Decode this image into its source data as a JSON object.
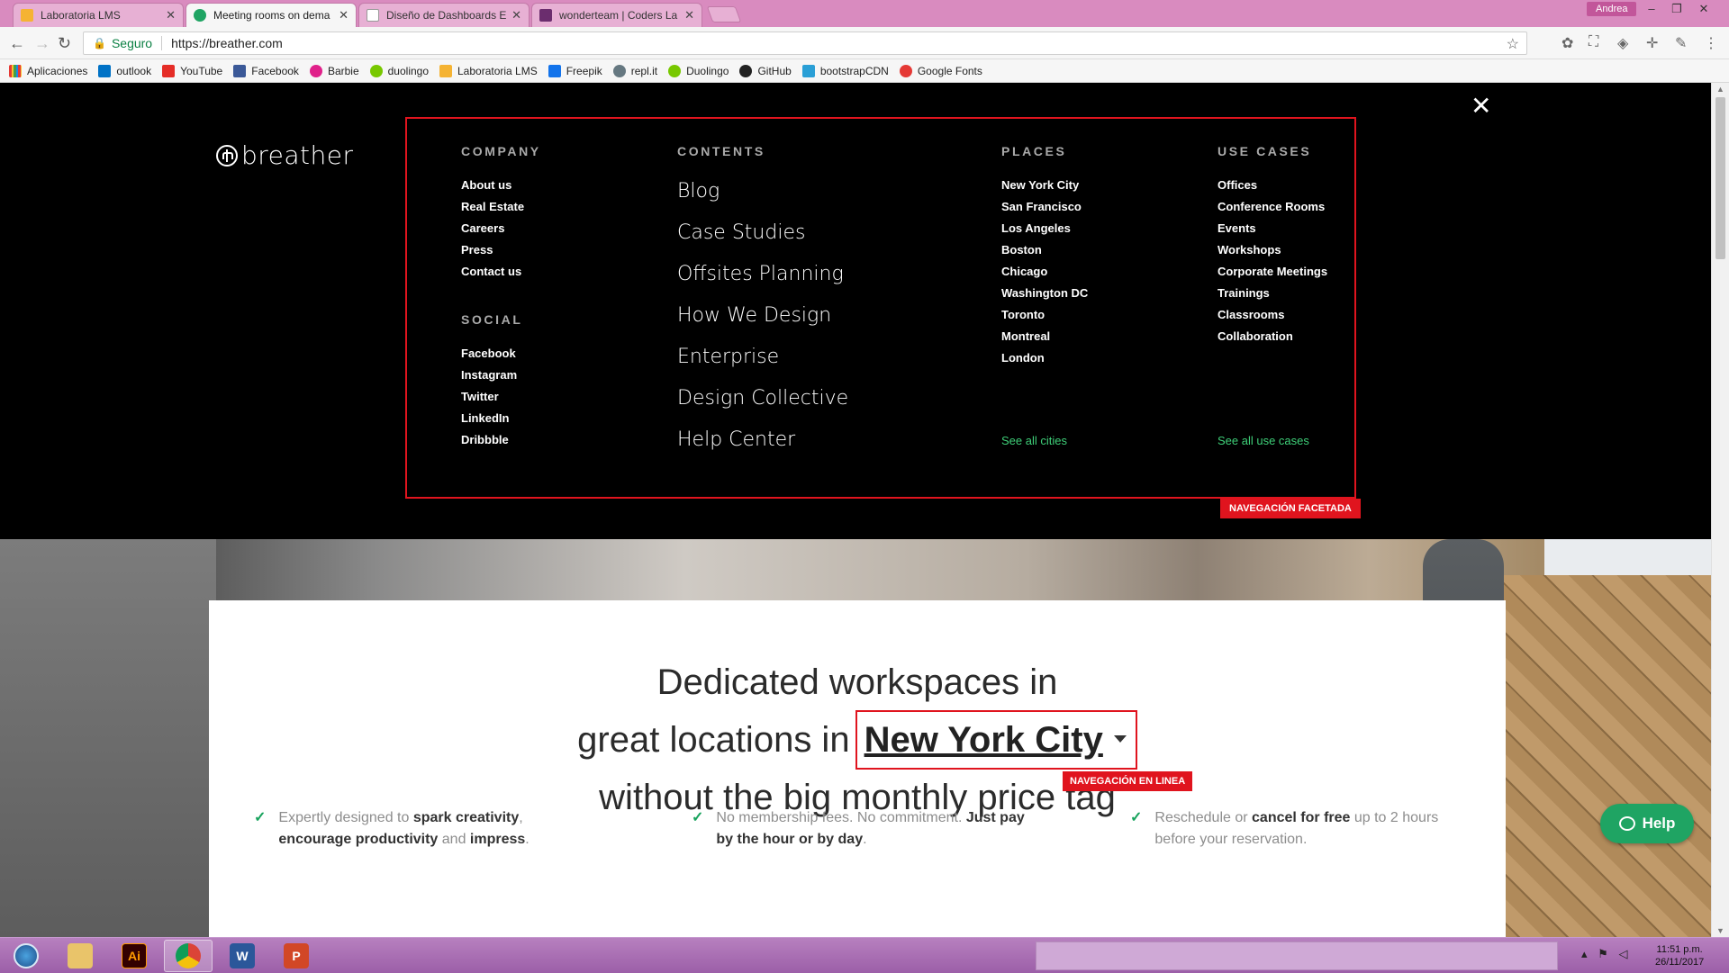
{
  "browser": {
    "tabs": [
      {
        "title": "Laboratoria LMS",
        "active": false,
        "favicon_color": "#f5b333"
      },
      {
        "title": "Meeting rooms on dema",
        "active": true,
        "favicon_color": "#1fa463"
      },
      {
        "title": "Diseño de Dashboards E",
        "active": false,
        "favicon_color": "#9e9e9e"
      },
      {
        "title": "wonderteam | Coders La",
        "active": false,
        "favicon_color": "#6b2d6e"
      }
    ],
    "user": "Andrea",
    "address": {
      "secure_label": "Seguro",
      "url": "https://breather.com"
    },
    "bookmarks": [
      {
        "label": "Aplicaciones",
        "icon": "apps-grid-icon",
        "color": "#e53935"
      },
      {
        "label": "outlook",
        "icon": "outlook-icon",
        "color": "#0072c6"
      },
      {
        "label": "YouTube",
        "icon": "youtube-icon",
        "color": "#e52d27"
      },
      {
        "label": "Facebook",
        "icon": "facebook-icon",
        "color": "#3b5998"
      },
      {
        "label": "Barbie",
        "icon": "barbie-icon",
        "color": "#e0218a"
      },
      {
        "label": "duolingo",
        "icon": "duolingo-icon",
        "color": "#78c800"
      },
      {
        "label": "Laboratoria LMS",
        "icon": "laboratoria-icon",
        "color": "#f5b333"
      },
      {
        "label": "Freepik",
        "icon": "freepik-icon",
        "color": "#1273eb"
      },
      {
        "label": "repl.it",
        "icon": "replit-icon",
        "color": "#667881"
      },
      {
        "label": "Duolingo",
        "icon": "duolingo-icon",
        "color": "#78c800"
      },
      {
        "label": "GitHub",
        "icon": "github-icon",
        "color": "#222222"
      },
      {
        "label": "bootstrapCDN",
        "icon": "bootstrap-icon",
        "color": "#2a9fd6"
      },
      {
        "label": "Google Fonts",
        "icon": "google-fonts-icon",
        "color": "#e53935"
      }
    ]
  },
  "menu": {
    "logo": "breather",
    "company": {
      "heading": "COMPANY",
      "items": [
        "About us",
        "Real Estate",
        "Careers",
        "Press",
        "Contact us"
      ]
    },
    "social": {
      "heading": "SOCIAL",
      "items": [
        "Facebook",
        "Instagram",
        "Twitter",
        "LinkedIn",
        "Dribbble"
      ]
    },
    "contents": {
      "heading": "CONTENTS",
      "items": [
        "Blog",
        "Case Studies",
        "Offsites Planning",
        "How We Design",
        "Enterprise",
        "Design Collective",
        "Help Center"
      ]
    },
    "places": {
      "heading": "PLACES",
      "items": [
        "New York City",
        "San Francisco",
        "Los Angeles",
        "Boston",
        "Chicago",
        "Washington DC",
        "Toronto",
        "Montreal",
        "London"
      ],
      "see_all": "See all cities"
    },
    "use_cases": {
      "heading": "USE CASES",
      "items": [
        "Offices",
        "Conference Rooms",
        "Events",
        "Workshops",
        "Corporate Meetings",
        "Trainings",
        "Classrooms",
        "Collaboration"
      ],
      "see_all": "See all use cases"
    },
    "facet_label": "NAVEGACIÓN FACETADA"
  },
  "hero": {
    "line1": "Dedicated workspaces in",
    "line2_prefix": "great locations in",
    "city": "New York City",
    "line3": "without the big monthly price tag",
    "inline_label": "NAVEGACIÓN EN LINEA",
    "benefits": [
      {
        "t1": "Expertly designed to ",
        "b1": "spark creativity",
        "t2": ",",
        "b2": "encourage productivity",
        "t3": " and ",
        "b3": "impress",
        "t4": "."
      },
      {
        "t1": "No membership fees. No commitment. ",
        "b1": "Just pay",
        "b2": "by the hour or by day",
        "t2": "."
      },
      {
        "t1": "Reschedule or ",
        "b1": "cancel for free",
        "t2": " up to 2 hours",
        "t3": "before your reservation."
      }
    ],
    "help": "Help"
  },
  "taskbar": {
    "apps": [
      {
        "name": "start",
        "label": ""
      },
      {
        "name": "explorer",
        "label": ""
      },
      {
        "name": "illustrator",
        "label": "Ai"
      },
      {
        "name": "chrome",
        "label": ""
      },
      {
        "name": "word",
        "label": "W"
      },
      {
        "name": "powerpoint",
        "label": "P"
      }
    ],
    "time": "11:51 p.m.",
    "date": "26/11/2017"
  }
}
